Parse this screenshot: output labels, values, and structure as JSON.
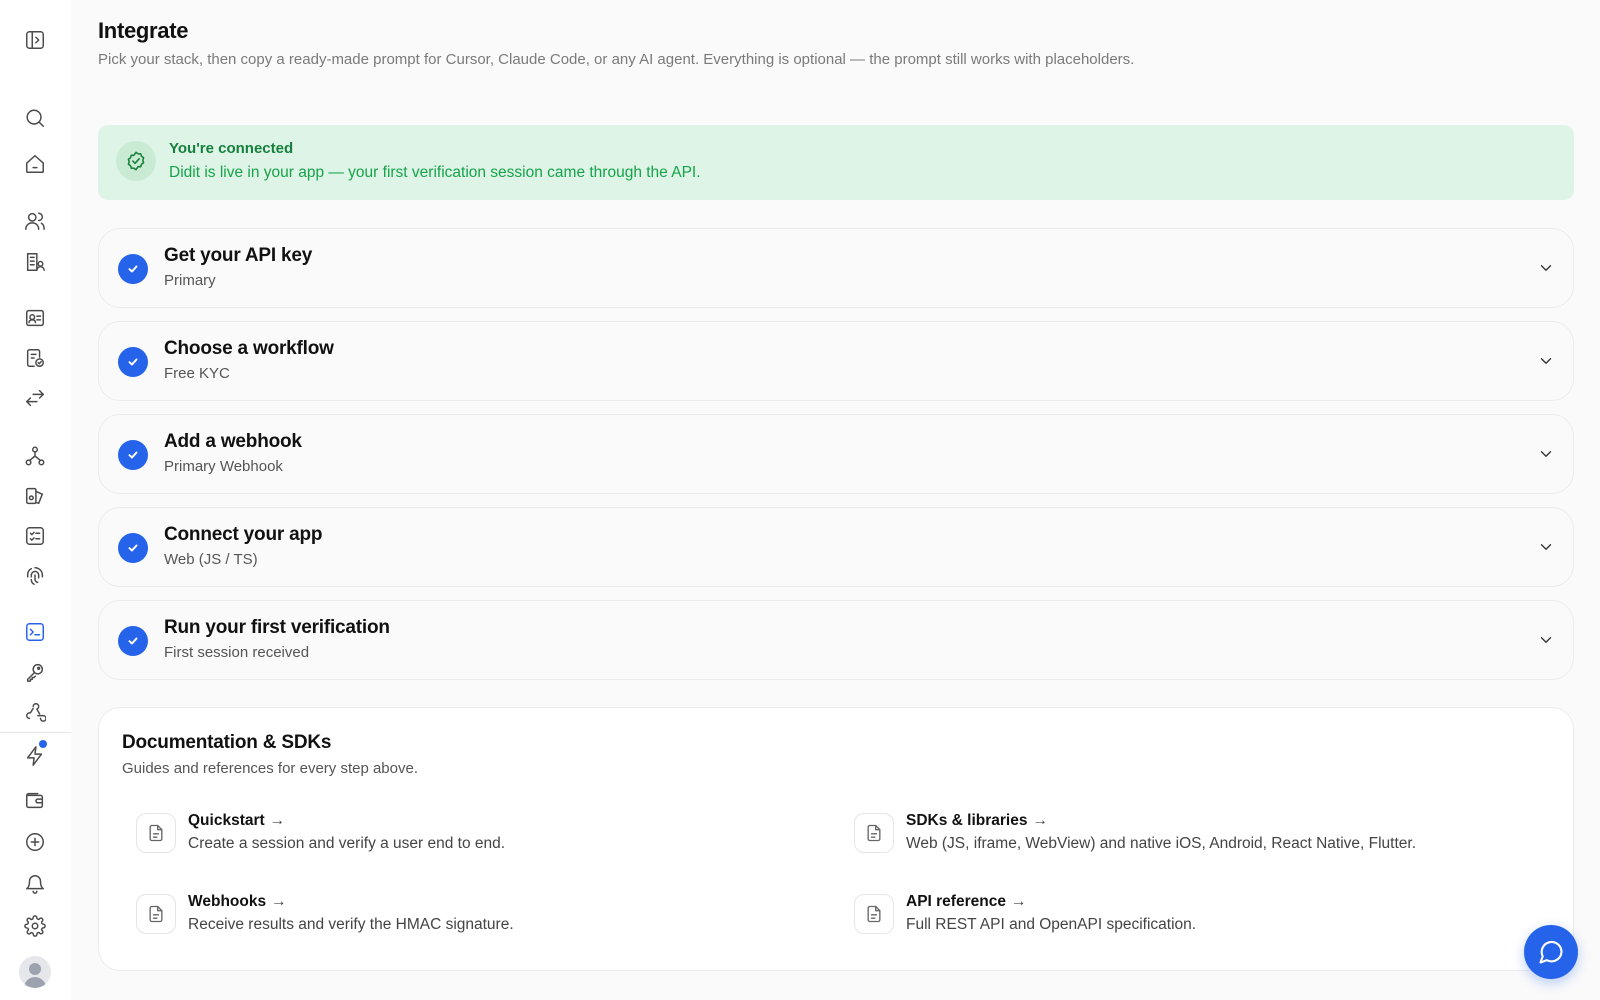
{
  "page": {
    "title": "Integrate",
    "subtitle": "Pick your stack, then copy a ready-made prompt for Cursor, Claude Code, or any AI agent. Everything is optional — the prompt still works with placeholders."
  },
  "banner": {
    "title": "You're connected",
    "text": "Didit is live in your app — your first verification session came through the API.",
    "icon": "badge-check-icon",
    "colors": {
      "background": "#def4e6",
      "title": "#15803d",
      "text": "#16a34a"
    }
  },
  "steps": [
    {
      "title": "Get your API key",
      "subtitle": "Primary",
      "status": "complete"
    },
    {
      "title": "Choose a workflow",
      "subtitle": "Free KYC",
      "status": "complete"
    },
    {
      "title": "Add a webhook",
      "subtitle": "Primary Webhook",
      "status": "complete"
    },
    {
      "title": "Connect your app",
      "subtitle": "Web (JS / TS)",
      "status": "complete"
    },
    {
      "title": "Run your first verification",
      "subtitle": "First session received",
      "status": "complete"
    }
  ],
  "docs": {
    "title": "Documentation & SDKs",
    "subtitle": "Guides and references for every step above.",
    "arrow": "→",
    "items": [
      {
        "title": "Quickstart",
        "desc": "Create a session and verify a user end to end."
      },
      {
        "title": "SDKs & libraries",
        "desc": "Web (JS, iframe, WebView) and native iOS, Android, React Native, Flutter."
      },
      {
        "title": "Webhooks",
        "desc": "Receive results and verify the HMAC signature."
      },
      {
        "title": "API reference",
        "desc": "Full REST API and OpenAPI specification."
      }
    ]
  },
  "sidebar": {
    "icons": [
      "expand-sidebar-icon",
      "search-icon",
      "home-icon",
      "users-icon",
      "building-icon",
      "id-card-icon",
      "document-check-icon",
      "transfer-icon",
      "workflow-icon",
      "layers-icon",
      "checklist-icon",
      "fingerprint-icon",
      "terminal-icon",
      "key-icon",
      "webhook-icon",
      "zap-icon",
      "wallet-icon",
      "plus-circle-icon",
      "bell-icon",
      "settings-icon"
    ],
    "active": "terminal-icon"
  },
  "colors": {
    "accent": "#2563eb",
    "background": "#fafafa"
  }
}
